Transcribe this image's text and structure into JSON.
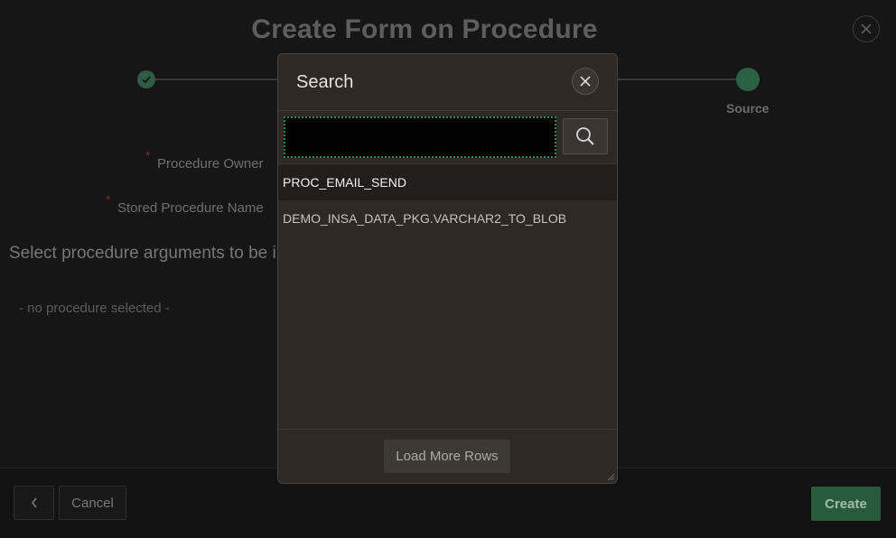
{
  "page": {
    "title": "Create Form on Procedure",
    "close_label": "Close"
  },
  "wizard": {
    "steps": [
      {
        "label": "",
        "state": "complete"
      },
      {
        "label": "Source",
        "state": "current"
      }
    ]
  },
  "form": {
    "procedure_owner_label": "Procedure Owner",
    "stored_procedure_label": "Stored Procedure Name",
    "required_marker": "*",
    "arguments_heading": "Select procedure arguments to be incl",
    "empty_message": "- no procedure selected -"
  },
  "footer": {
    "back_icon": "chevron-left-icon",
    "cancel_label": "Cancel",
    "create_label": "Create"
  },
  "dialog": {
    "title": "Search",
    "search": {
      "value": "",
      "placeholder": ""
    },
    "results": [
      {
        "label": "PROC_EMAIL_SEND",
        "selected": true
      },
      {
        "label": "DEMO_INSA_DATA_PKG.VARCHAR2_TO_BLOB",
        "selected": false
      }
    ],
    "load_more_label": "Load More Rows"
  },
  "colors": {
    "accent_green": "#2a5a3e",
    "dialog_bg": "#2e2925",
    "focus_ring": "#2e8a52"
  }
}
